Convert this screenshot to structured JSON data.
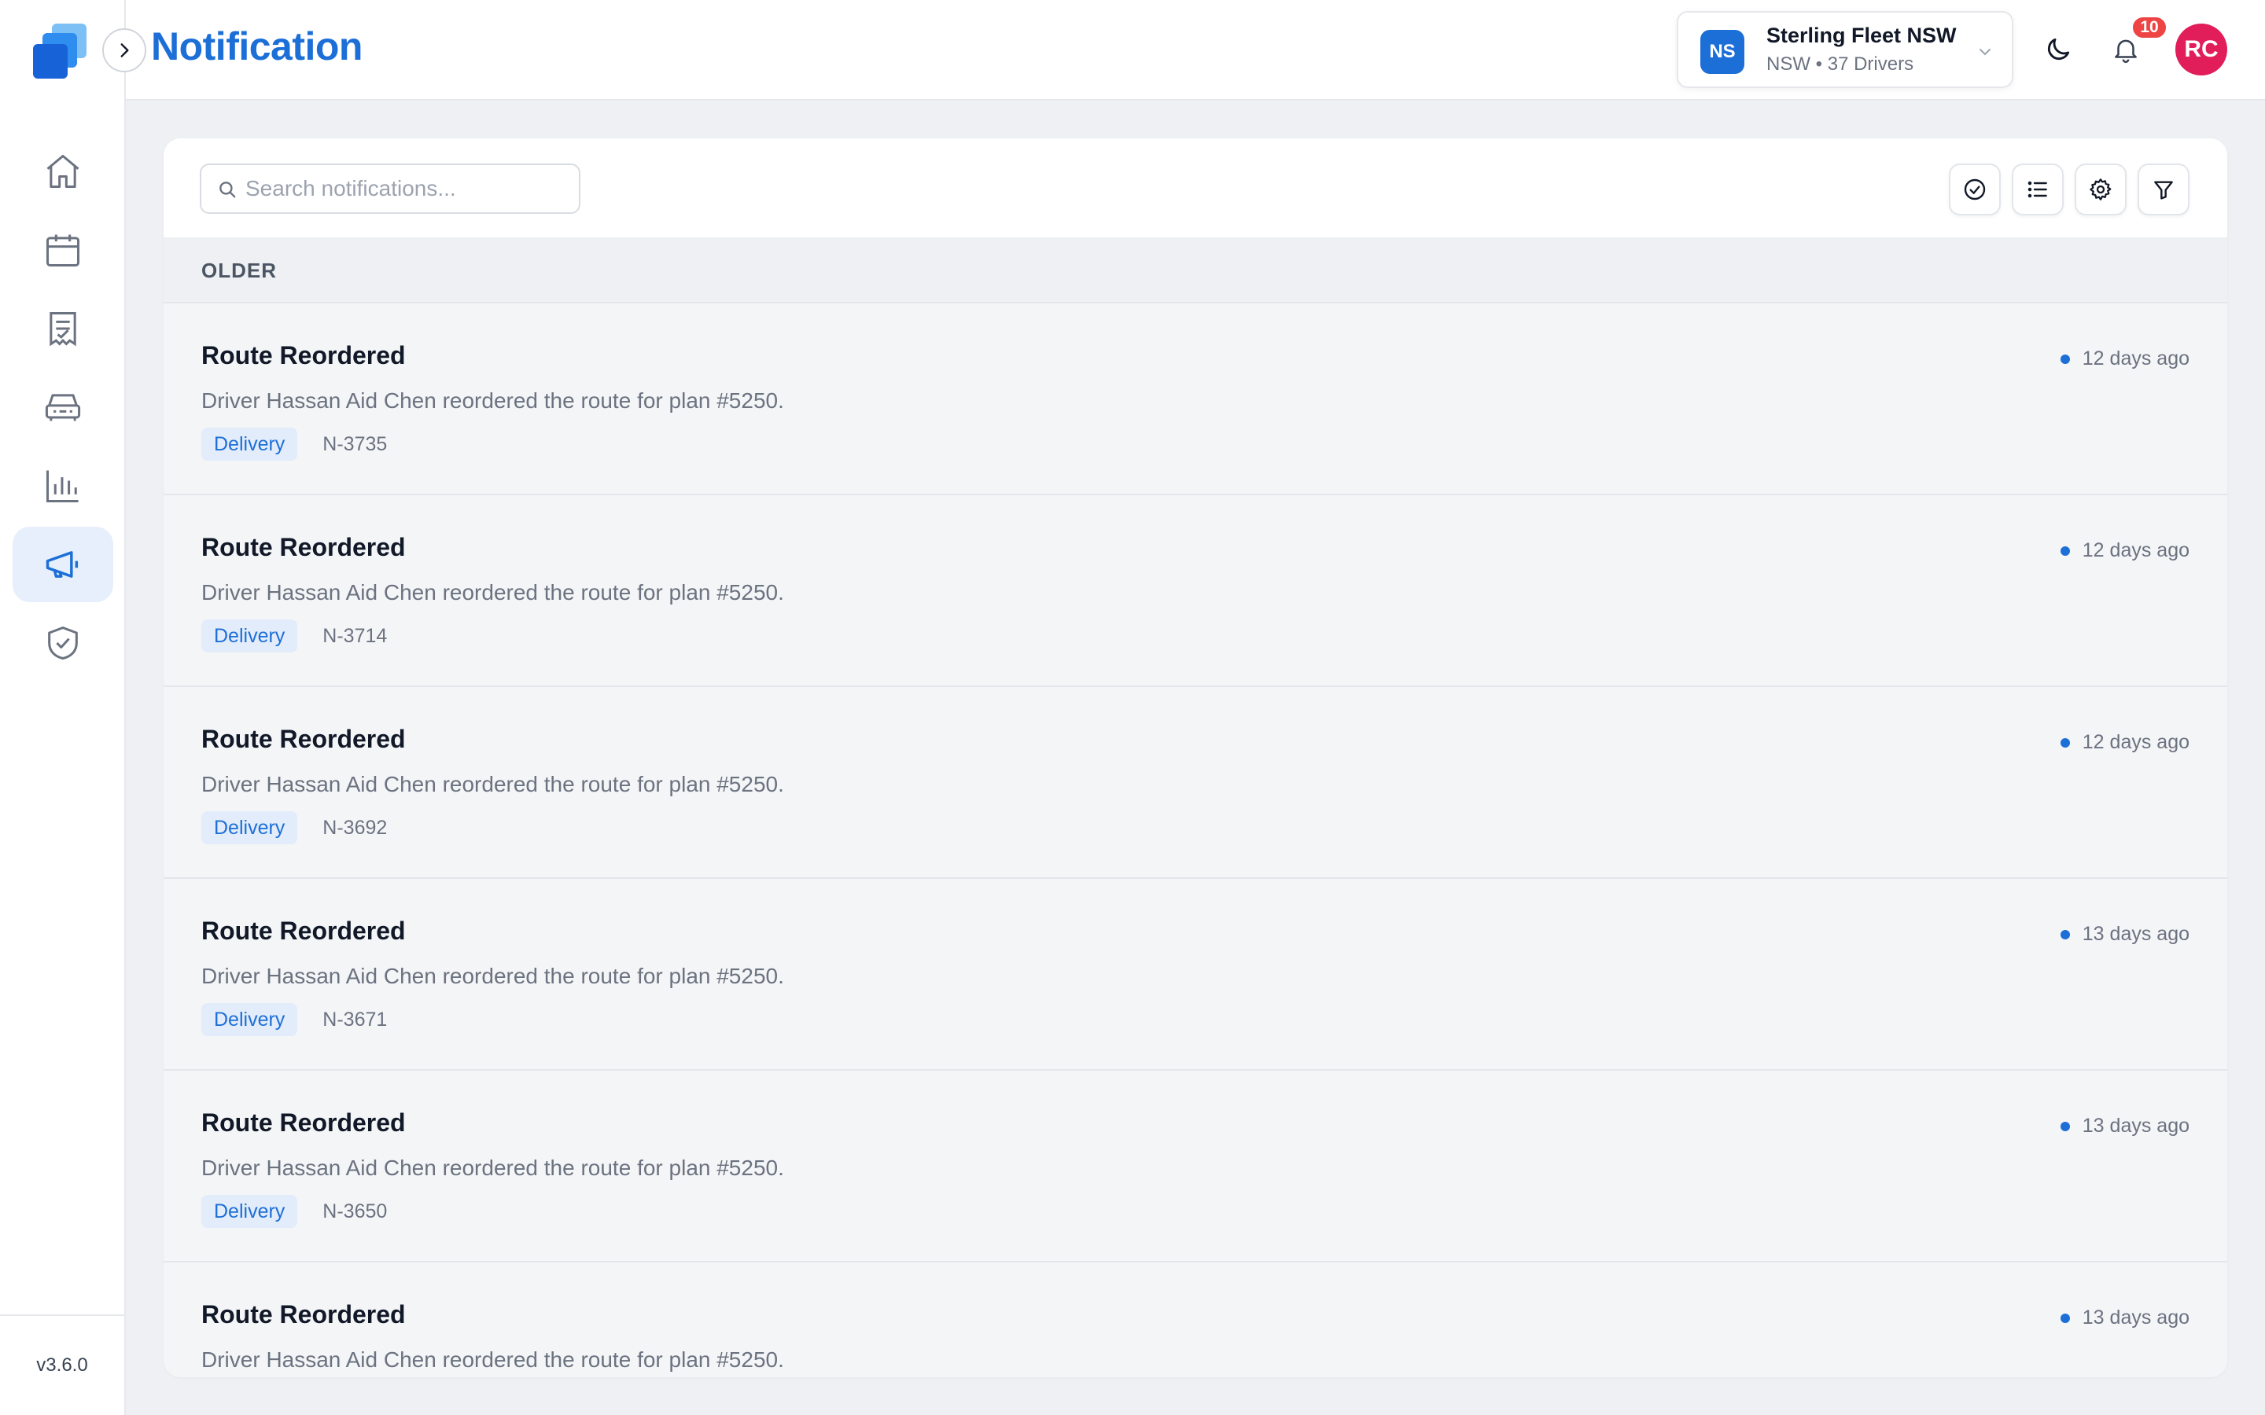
{
  "app": {
    "page_title": "Notification",
    "version": "v3.6.0",
    "accent_color": "#1d6fd8"
  },
  "sidebar": {
    "items": [
      {
        "icon": "home-icon",
        "active": false
      },
      {
        "icon": "calendar-icon",
        "active": false
      },
      {
        "icon": "receipt-icon",
        "active": false
      },
      {
        "icon": "car-icon",
        "active": false
      },
      {
        "icon": "bar-chart-icon",
        "active": false
      },
      {
        "icon": "megaphone-icon",
        "active": true
      },
      {
        "icon": "shield-check-icon",
        "active": false
      }
    ]
  },
  "header": {
    "org": {
      "badge": "NS",
      "name": "Sterling Fleet NSW",
      "subtitle": "NSW • 37 Drivers"
    },
    "notification_count": "10",
    "avatar_initials": "RC"
  },
  "toolbar": {
    "search_placeholder": "Search notifications...",
    "buttons": [
      "check-circle-icon",
      "list-icon",
      "gear-icon",
      "filter-icon"
    ]
  },
  "section": {
    "label": "OLDER"
  },
  "notifications": [
    {
      "title": "Route Reordered",
      "message": "Driver Hassan Aid Chen reordered the route for plan #5250.",
      "tag": "Delivery",
      "code": "N-3735",
      "time": "12 days ago",
      "unread": true
    },
    {
      "title": "Route Reordered",
      "message": "Driver Hassan Aid Chen reordered the route for plan #5250.",
      "tag": "Delivery",
      "code": "N-3714",
      "time": "12 days ago",
      "unread": true
    },
    {
      "title": "Route Reordered",
      "message": "Driver Hassan Aid Chen reordered the route for plan #5250.",
      "tag": "Delivery",
      "code": "N-3692",
      "time": "12 days ago",
      "unread": true
    },
    {
      "title": "Route Reordered",
      "message": "Driver Hassan Aid Chen reordered the route for plan #5250.",
      "tag": "Delivery",
      "code": "N-3671",
      "time": "13 days ago",
      "unread": true
    },
    {
      "title": "Route Reordered",
      "message": "Driver Hassan Aid Chen reordered the route for plan #5250.",
      "tag": "Delivery",
      "code": "N-3650",
      "time": "13 days ago",
      "unread": true
    },
    {
      "title": "Route Reordered",
      "message": "Driver Hassan Aid Chen reordered the route for plan #5250.",
      "tag": "",
      "code": "",
      "time": "13 days ago",
      "unread": true
    }
  ]
}
